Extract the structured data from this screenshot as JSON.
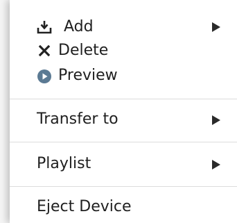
{
  "menu": {
    "group1": [
      {
        "label": "Add",
        "icon": "add-to-tray-icon",
        "has_submenu": true
      },
      {
        "label": "Delete",
        "icon": "x-icon",
        "has_submenu": false
      },
      {
        "label": "Preview",
        "icon": "play-circle-icon",
        "has_submenu": false
      }
    ],
    "transfer": {
      "label": "Transfer to",
      "has_submenu": true
    },
    "playlist": {
      "label": "Playlist",
      "has_submenu": true
    },
    "eject": {
      "label": "Eject Device",
      "has_submenu": false
    }
  },
  "colors": {
    "icon_blue": "#5b7a93",
    "text": "#1f1f1f",
    "separator": "#dcdcdc"
  }
}
